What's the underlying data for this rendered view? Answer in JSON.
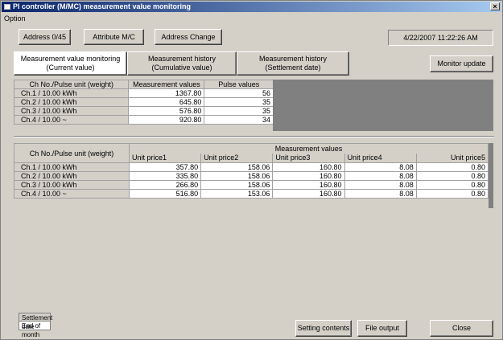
{
  "window": {
    "title": "PI controller (M/MC) measurement value monitoring",
    "close_label": "×"
  },
  "menu": {
    "option": "Option"
  },
  "top_tabs": [
    {
      "label": "Address 0/45"
    },
    {
      "label": "Attribute M/C"
    },
    {
      "label": "Address Change"
    }
  ],
  "datetime": "4/22/2007 11:22:26 AM",
  "view_tabs": [
    {
      "label": "Measurement value monitoring (Current value)"
    },
    {
      "label": "Measurement history (Cumulative value)"
    },
    {
      "label": "Measurement history (Settlement date)"
    }
  ],
  "monitor_update_label": "Monitor update",
  "table1": {
    "headers": [
      "Ch No./Pulse unit (weight)",
      "Measurement values",
      "Pulse values"
    ],
    "rows": [
      {
        "label": "Ch.1 / 10.00 kWh",
        "measurement": "1367.80",
        "pulse": "56"
      },
      {
        "label": "Ch.2 / 10.00 kWh",
        "measurement": "645.80",
        "pulse": "35"
      },
      {
        "label": "Ch.3 / 10.00 kWh",
        "measurement": "576.80",
        "pulse": "35"
      },
      {
        "label": "Ch.4 / 10.00 ~",
        "measurement": "920.80",
        "pulse": "34"
      }
    ]
  },
  "table2": {
    "header_label": "Ch No./Pulse unit (weight)",
    "group_header": "Measurement values",
    "subheaders": [
      "Unit price1",
      "Unit price2",
      "Unit price3",
      "Unit price4",
      "Unit price5"
    ],
    "rows": [
      {
        "label": "Ch.1 / 10.00 kWh",
        "values": [
          "357.80",
          "158.06",
          "160.80",
          "8.08",
          "0.80"
        ]
      },
      {
        "label": "Ch.2 / 10.00 kWh",
        "values": [
          "335.80",
          "158.06",
          "160.80",
          "8.08",
          "0.80"
        ]
      },
      {
        "label": "Ch.3 / 10.00 kWh",
        "values": [
          "266.80",
          "158.06",
          "160.80",
          "8.08",
          "0.80"
        ]
      },
      {
        "label": "Ch.4 / 10.00 ~",
        "values": [
          "516.80",
          "153.06",
          "160.80",
          "8.08",
          "0.80"
        ]
      }
    ]
  },
  "settlement": {
    "label": "Settlement date",
    "value": "End of month"
  },
  "footer_buttons": {
    "setting_contents": "Setting contents",
    "file_output": "File output",
    "close": "Close"
  }
}
